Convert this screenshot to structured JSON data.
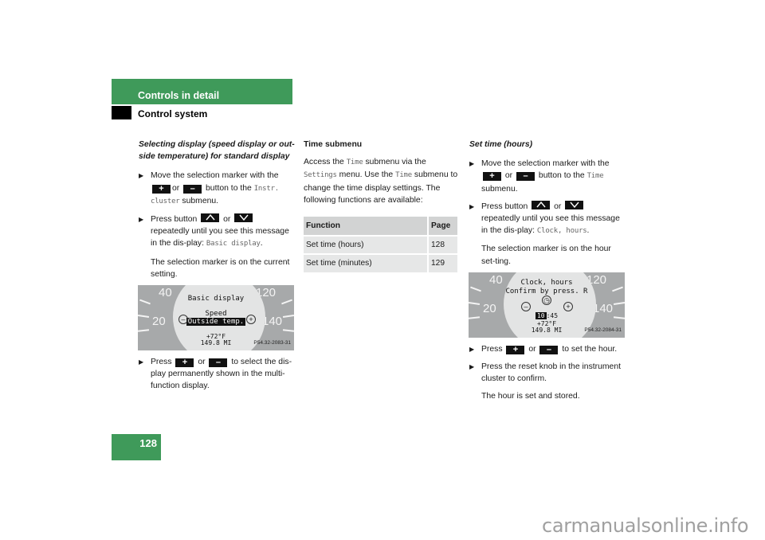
{
  "header": {
    "section": "Controls in detail",
    "subsection": "Control system"
  },
  "col1": {
    "heading": "Selecting display (speed display or out-side temperature) for standard display",
    "step1": {
      "pre": "Move the selection marker with the",
      "or": "or",
      "post": "button to the",
      "menu": "Instr. cluster",
      "end": "submenu."
    },
    "step2": {
      "pre": "Press button",
      "or": "or",
      "post": "repeatedly until you see this message in the dis-play:",
      "msg": "Basic display",
      "end": "."
    },
    "note1": "The selection marker is on the current setting.",
    "gauge": {
      "title": "Basic display",
      "option1": "Speed",
      "option2": "Outside temp.",
      "temp": "+72°F",
      "odo": "149.8 MI",
      "nums": [
        "40",
        "20",
        "120",
        "140"
      ],
      "code": "P54.32-2083-31"
    },
    "step3": {
      "pre": "Press",
      "or": "or",
      "post": "to select the dis-play permanently shown in the multi-function display."
    }
  },
  "col2": {
    "heading": "Time submenu",
    "para": {
      "a": "Access the",
      "m1": "Time",
      "b": "submenu via the",
      "m2": "Settings",
      "c": "menu. Use the",
      "m3": "Time",
      "d": "submenu to change the time display settings. The following functions are available:"
    },
    "table": {
      "headers": [
        "Function",
        "Page"
      ],
      "rows": [
        [
          "Set time (hours)",
          "128"
        ],
        [
          "Set time (minutes)",
          "129"
        ]
      ]
    }
  },
  "col3": {
    "heading": "Set time (hours)",
    "step1": {
      "pre": "Move the selection marker with the",
      "or": "or",
      "post": "button to the",
      "menu": "Time",
      "end": "submenu."
    },
    "step2": {
      "pre": "Press button",
      "or": "or",
      "post": "repeatedly until you see this message in the dis-play:",
      "msg": "Clock, hours",
      "end": "."
    },
    "note1": "The selection marker is on the hour set-ting.",
    "gauge": {
      "title": "Clock, hours",
      "subtitle": "Confirm by press. R",
      "hour": "10",
      "minute": ":45",
      "temp": "+72°F",
      "odo": "149.8 MI",
      "nums": [
        "40",
        "20",
        "120",
        "140"
      ],
      "code": "P54.32-2084-31"
    },
    "step3": {
      "pre": "Press",
      "or": "or",
      "post": "to set the hour."
    },
    "step4": "Press the reset knob in the instrument cluster to confirm.",
    "note2": "The hour is set and stored."
  },
  "footer": {
    "page_number": "128",
    "watermark": "carmanualsonline.info"
  },
  "colors": {
    "brand_green": "#3f9a5a"
  }
}
